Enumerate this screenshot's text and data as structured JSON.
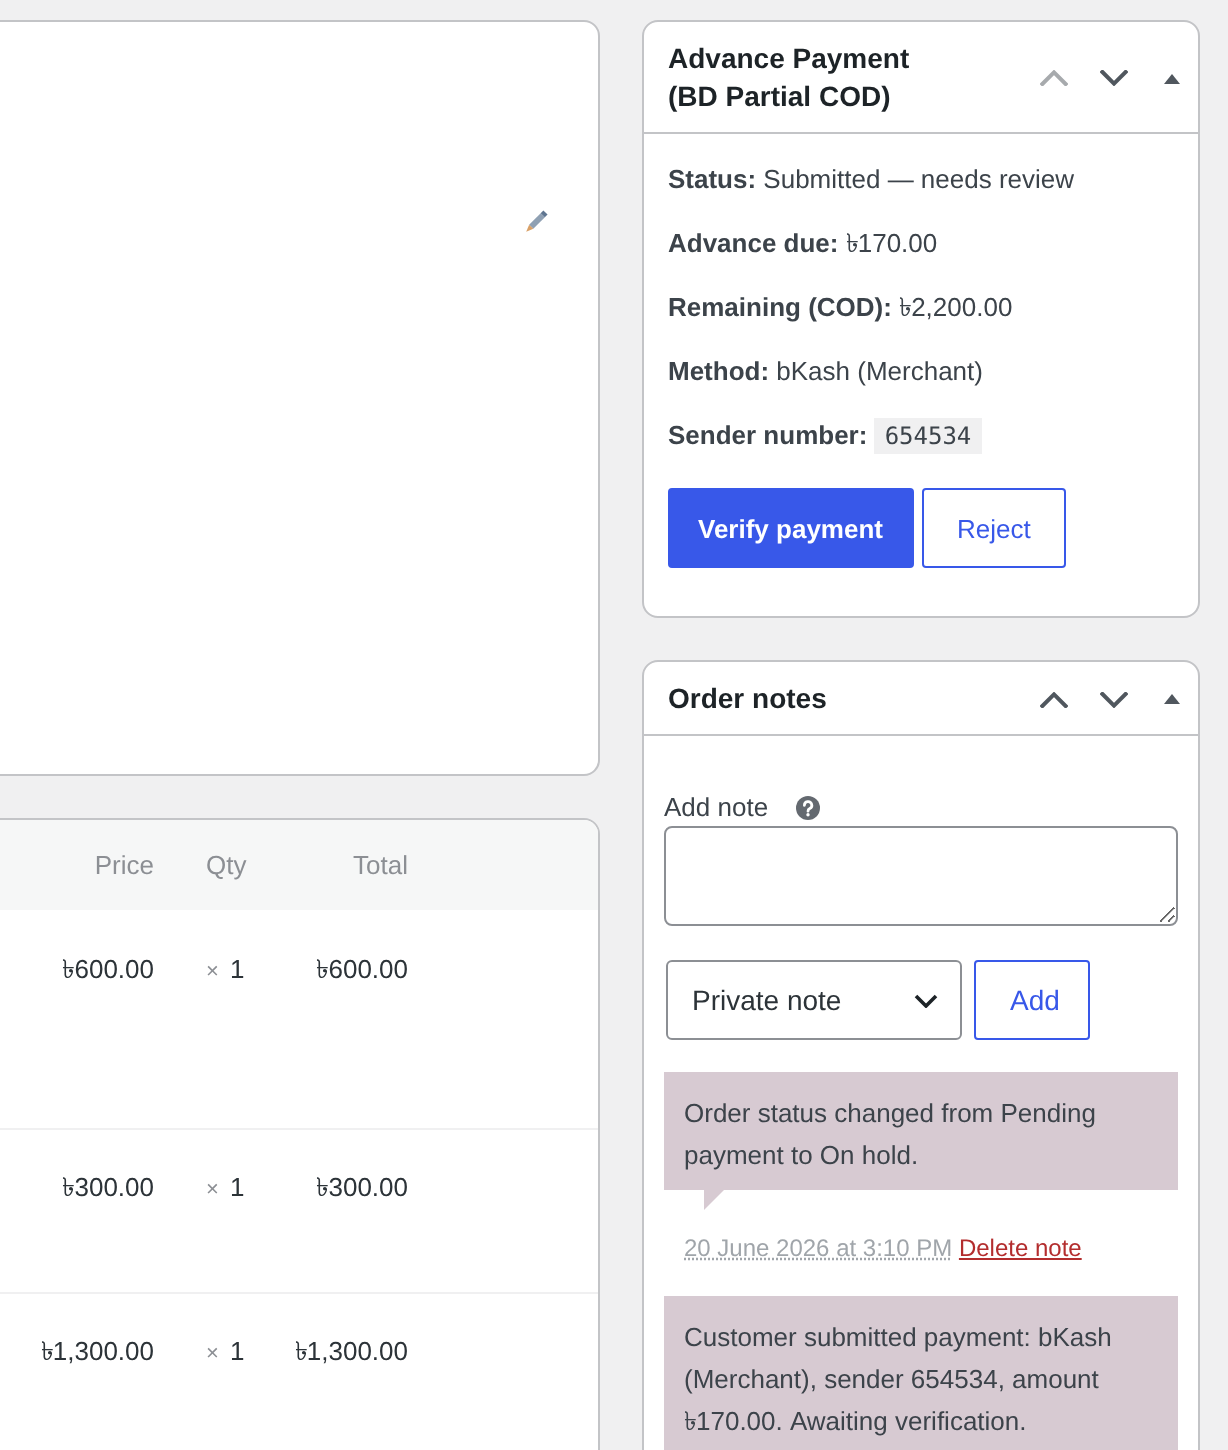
{
  "items_table": {
    "columns": [
      "Price",
      "Qty",
      "Total"
    ],
    "rows": [
      {
        "price": "৳600.00",
        "multiplier": "×",
        "qty": "1",
        "total": "৳600.00"
      },
      {
        "price": "৳300.00",
        "multiplier": "×",
        "qty": "1",
        "total": "৳300.00"
      },
      {
        "price": "৳1,300.00",
        "multiplier": "×",
        "qty": "1",
        "total": "৳1,300.00"
      }
    ]
  },
  "payment_panel": {
    "title": "Advance Payment (BD Partial COD)",
    "move_controls": [
      {
        "kind": "up",
        "disabled": true
      },
      {
        "kind": "down",
        "disabled": false
      }
    ],
    "expanded": true,
    "fields": [
      {
        "kind": "text",
        "text": "**Status:** Submitted — needs review"
      },
      {
        "kind": "text",
        "text": "**Advance due:** ৳170.00"
      },
      {
        "kind": "text",
        "text": "**Remaining (COD):** ৳2,200.00"
      },
      {
        "kind": "text",
        "text": "**Method:** bKash (Merchant)"
      },
      {
        "kind": "code",
        "label": "Sender number:",
        "value": "654534"
      }
    ],
    "buttons": [
      {
        "label": "Verify payment",
        "kind": "primary"
      },
      {
        "label": "Reject",
        "kind": "secondary"
      }
    ]
  },
  "notes_panel": {
    "title": "Order notes",
    "move_controls": [
      {
        "kind": "up",
        "disabled": false
      },
      {
        "kind": "down",
        "disabled": false
      }
    ],
    "expanded": true,
    "add_note_label": "Add note",
    "note_type": "Private note",
    "add_button": "Add",
    "notes": [
      {
        "text": "Order status changed from Pending payment to On hold.",
        "date": "20 June 2026 at 3:10 PM",
        "delete_label": "Delete note"
      },
      {
        "text": "Customer submitted payment: bKash (Merchant), sender 654534, amount ৳170.00. Awaiting verification."
      }
    ]
  }
}
